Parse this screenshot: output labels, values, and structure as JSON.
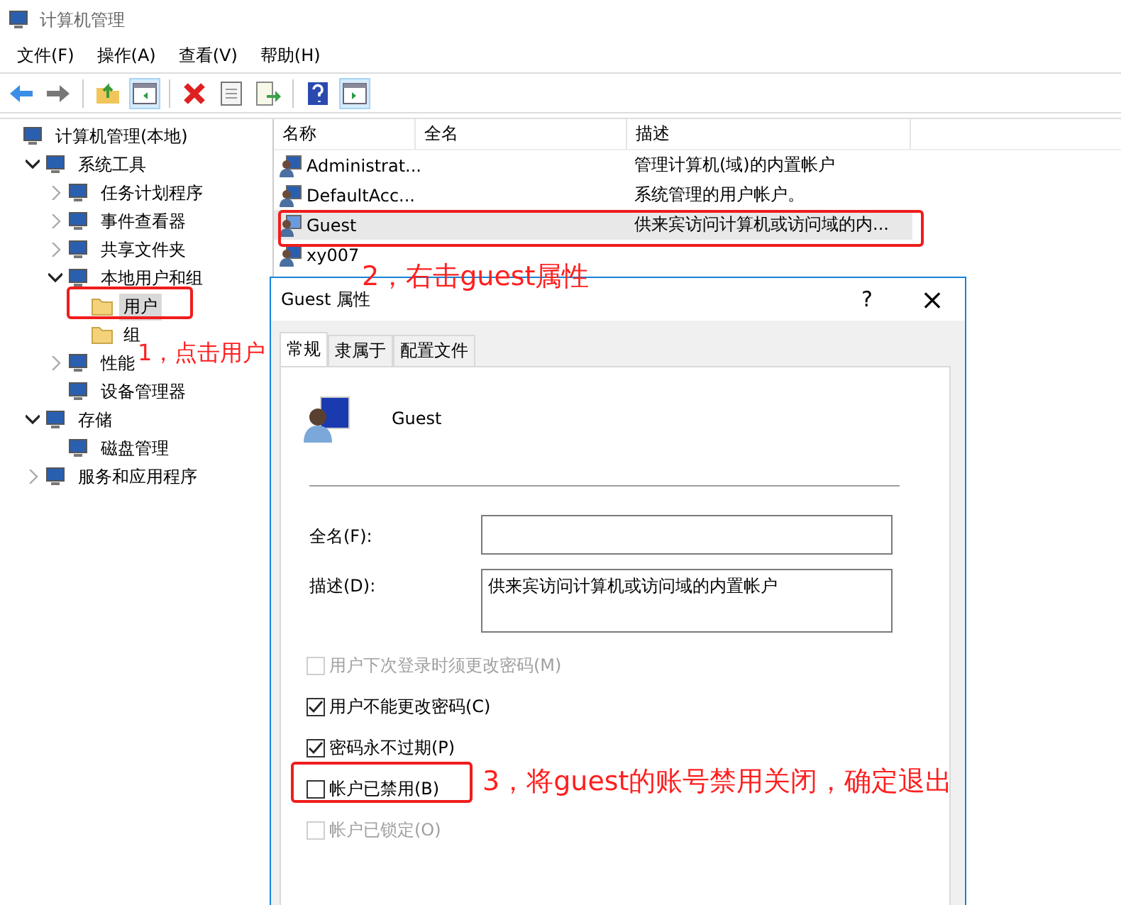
{
  "window": {
    "title": "计算机管理"
  },
  "menu": [
    "文件(F)",
    "操作(A)",
    "查看(V)",
    "帮助(H)"
  ],
  "tree": [
    {
      "label": "计算机管理(本地)",
      "selected": false,
      "children": [
        {
          "label": "系统工具",
          "expanded": true,
          "selected": false,
          "children": [
            {
              "label": "任务计划程序",
              "expanded": false,
              "selected": false
            },
            {
              "label": "事件查看器",
              "expanded": false,
              "selected": false
            },
            {
              "label": "共享文件夹",
              "expanded": false,
              "selected": false
            },
            {
              "label": "本地用户和组",
              "expanded": true,
              "selected": false,
              "children": [
                {
                  "label": "用户",
                  "selected": true
                },
                {
                  "label": "组",
                  "selected": false
                }
              ]
            },
            {
              "label": "性能",
              "expanded": false,
              "selected": false
            },
            {
              "label": "设备管理器",
              "selected": false
            }
          ]
        },
        {
          "label": "存储",
          "expanded": true,
          "selected": false,
          "children": [
            {
              "label": "磁盘管理",
              "selected": false
            }
          ]
        },
        {
          "label": "服务和应用程序",
          "expanded": false,
          "selected": false
        }
      ]
    }
  ],
  "table": {
    "columns": [
      "名称",
      "全名",
      "描述"
    ],
    "rows": [
      {
        "name": "Administrat...",
        "description": "管理计算机(域)的内置帐户",
        "selected": false
      },
      {
        "name": "DefaultAcc...",
        "description": "系统管理的用户帐户。",
        "selected": false
      },
      {
        "name": "Guest",
        "description": "供来宾访问计算机或访问域的内...",
        "selected": true
      },
      {
        "name": "xy007",
        "selected": false
      }
    ]
  },
  "dialog": {
    "title": "Guest 属性",
    "help": "?",
    "close": "×",
    "tabs": [
      {
        "label": "常规",
        "selected": true
      },
      {
        "label": "隶属于",
        "selected": false
      },
      {
        "label": "配置文件",
        "selected": false
      }
    ],
    "user_name": "Guest",
    "fields": [
      {
        "label": "全名(F):",
        "kind": "line"
      },
      {
        "label": "描述(D):",
        "value": "供来宾访问计算机或访问域的内置帐户",
        "kind": "area"
      }
    ],
    "checkboxes": [
      {
        "label": "用户下次登录时须更改密码(M)",
        "checked": false,
        "disabled": true
      },
      {
        "label": "用户不能更改密码(C)",
        "checked": true,
        "disabled": false
      },
      {
        "label": "密码永不过期(P)",
        "checked": true,
        "disabled": false
      },
      {
        "label": "帐户已禁用(B)",
        "checked": false,
        "disabled": false
      },
      {
        "label": "帐户已锁定(O)",
        "checked": false,
        "disabled": true
      }
    ]
  },
  "annotations": [
    "1，点击用户",
    "2，右击guest属性",
    "3，将guest的账号禁用关闭，确定退出"
  ]
}
